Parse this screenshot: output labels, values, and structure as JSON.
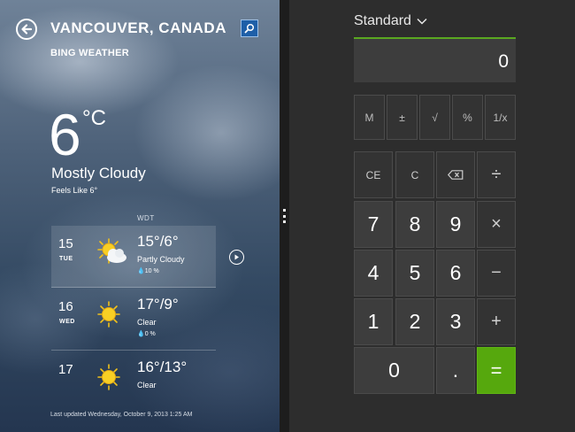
{
  "weather": {
    "city": "VANCOUVER, CANADA",
    "brand": "BING WEATHER",
    "temp": "6",
    "unit": "°C",
    "condition": "Mostly Cloudy",
    "feels_like": "Feels Like 6°",
    "timezone": "WDT",
    "forecast": [
      {
        "day": "15",
        "dow": "TUE",
        "hilo": "15°/6°",
        "condition": "Partly Cloudy",
        "precip": "10 %",
        "icon": "partly-cloudy-icon"
      },
      {
        "day": "16",
        "dow": "WED",
        "hilo": "17°/9°",
        "condition": "Clear",
        "precip": "0 %",
        "icon": "sunny-icon"
      },
      {
        "day": "17",
        "dow": "",
        "hilo": "16°/13°",
        "condition": "Clear",
        "precip": "",
        "icon": "sunny-icon"
      }
    ],
    "last_updated": "Last updated Wednesday, October 9, 2013 1:25 AM"
  },
  "calculator": {
    "mode": "Standard",
    "display": "0",
    "memory_keys": [
      "M",
      "±",
      "√",
      "%",
      "1/x"
    ],
    "keys": {
      "ce": "CE",
      "c": "C",
      "backspace_icon": "backspace-icon",
      "divide": "÷",
      "seven": "7",
      "eight": "8",
      "nine": "9",
      "multiply": "×",
      "four": "4",
      "five": "5",
      "six": "6",
      "minus": "−",
      "one": "1",
      "two": "2",
      "three": "3",
      "plus": "+",
      "zero": "0",
      "decimal": ".",
      "equals": "="
    },
    "accent_color": "#56a80d"
  }
}
